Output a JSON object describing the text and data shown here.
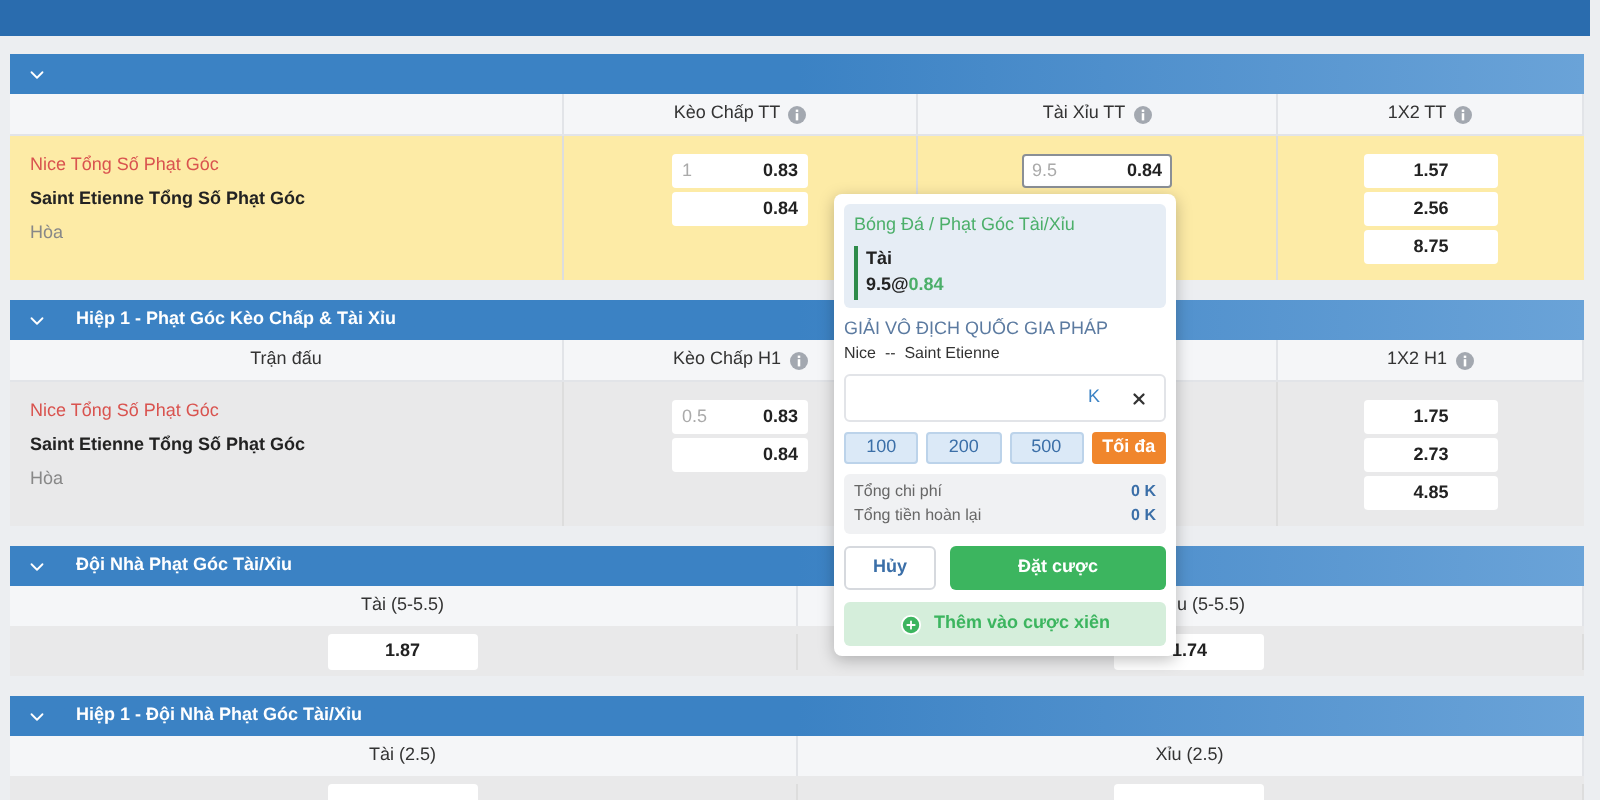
{
  "sections": [
    {
      "kind": "match",
      "columns": [
        {
          "info": false
        },
        {
          "label": "Kèo Chấp TT",
          "info": true
        },
        {
          "label": "Tài Xỉu TT",
          "info": true
        },
        {
          "label": "1X2 TT",
          "info": true
        }
      ],
      "highlight": true,
      "teams": [
        {
          "name": "Nice Tổng Số Phạt Góc",
          "kind": "home"
        },
        {
          "name": "Saint Etienne Tổng Số Phạt Góc",
          "kind": "away"
        },
        {
          "name": "Hòa",
          "kind": "draw"
        }
      ],
      "handicap": [
        {
          "line": "1",
          "odds": "0.83",
          "selected": false
        },
        {
          "odds": "0.84",
          "selected": false
        }
      ],
      "overunder": [
        {
          "line": "9.5",
          "odds": "0.84",
          "selected": true
        }
      ],
      "x12": [
        "1.57",
        "2.56",
        "8.75"
      ]
    },
    {
      "kind": "match",
      "title": "Hiệp 1 - Phạt Góc Kèo Chấp & Tài Xỉu",
      "columns": [
        {
          "label": "Trận đấu",
          "info": false
        },
        {
          "label": "Kèo Chấp H1",
          "info": true
        },
        {
          "kind": "covered"
        },
        {
          "label": "1X2 H1",
          "info": true
        }
      ],
      "highlight": false,
      "teams": [
        {
          "name": "Nice Tổng Số Phạt Góc",
          "kind": "home"
        },
        {
          "name": "Saint Etienne Tổng Số Phạt Góc",
          "kind": "away"
        },
        {
          "name": "Hòa",
          "kind": "draw"
        }
      ],
      "handicap": [
        {
          "line": "0.5",
          "odds": "0.83",
          "selected": false
        },
        {
          "odds": "0.84",
          "selected": false
        }
      ],
      "x12": [
        "1.75",
        "2.73",
        "4.85"
      ]
    },
    {
      "kind": "pair",
      "title": "Đội Nhà Phạt Góc Tài/Xỉu",
      "columns": [
        {
          "label": "Tài (5-5.5)",
          "odds": "1.87",
          "kind": "centered"
        },
        {
          "label": "u (5-5.5)",
          "odds": "1.74",
          "kind": "clipped"
        }
      ]
    },
    {
      "kind": "pair",
      "title": "Hiệp 1 - Đội Nhà Phạt Góc Tài/Xỉu",
      "columns": [
        {
          "label": "Tài (2.5)",
          "kind": "centered"
        },
        {
          "label": "Xỉu (2.5)",
          "kind": "centered"
        }
      ]
    }
  ],
  "betslip": {
    "category": "Bóng Đá / Phạt Góc Tài/Xỉu",
    "pick": "Tài",
    "line": "9.5",
    "at": "@",
    "odds": "0.84",
    "league": "GIẢI VÔ ĐỊCH QUỐC GIA PHÁP",
    "home": "Nice",
    "separator": "--",
    "away": "Saint Etienne",
    "unit": "K",
    "chips": [
      {
        "label": "100",
        "kind": "amount"
      },
      {
        "label": "200",
        "kind": "amount"
      },
      {
        "label": "500",
        "kind": "amount"
      },
      {
        "label": "Tối đa",
        "kind": "max"
      }
    ],
    "totals": [
      {
        "label": "Tổng chi phí",
        "value": "0 K"
      },
      {
        "label": "Tổng tiền hoàn lại",
        "value": "0 K"
      }
    ],
    "cancel": "Hủy",
    "submit": "Đặt cược",
    "parlay": "Thêm vào cược xiên"
  }
}
